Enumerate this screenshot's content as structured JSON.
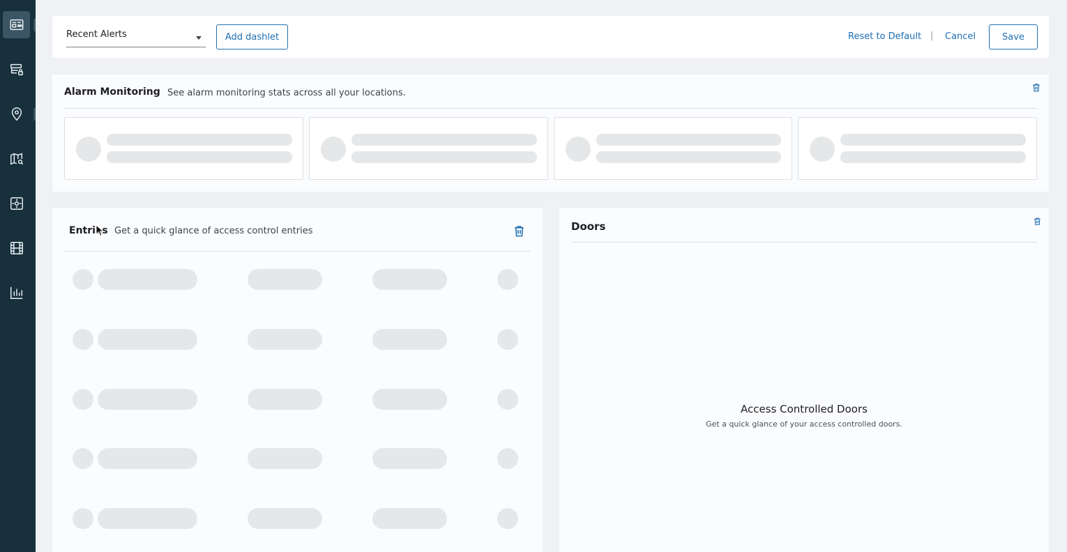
{
  "sidebar": {
    "items": [
      {
        "name": "dashboard",
        "icon": "dashboard-icon",
        "active": true
      },
      {
        "name": "devices",
        "icon": "server-lock-icon",
        "active": false
      },
      {
        "name": "locations",
        "icon": "location-pin-icon",
        "active": false
      },
      {
        "name": "maps",
        "icon": "map-search-icon",
        "active": false
      },
      {
        "name": "alarms",
        "icon": "sensor-icon",
        "active": false
      },
      {
        "name": "video",
        "icon": "film-icon",
        "active": false
      },
      {
        "name": "reports",
        "icon": "bar-chart-icon",
        "active": false
      }
    ]
  },
  "toolbar": {
    "dashlet_select_value": "Recent Alerts",
    "add_dashlet_label": "Add dashlet",
    "reset_label": "Reset to Default",
    "separator": "|",
    "cancel_label": "Cancel",
    "save_label": "Save"
  },
  "alarm_panel": {
    "title": "Alarm Monitoring",
    "subtitle": "See alarm monitoring stats across all your locations."
  },
  "entries_panel": {
    "title": "Entries",
    "subtitle": "Get a quick glance of access control entries"
  },
  "doors_panel": {
    "title": "Doors",
    "empty_title": "Access Controlled Doors",
    "empty_subtitle": "Get a quick glance of your access controlled doors."
  },
  "colors": {
    "sidebar_bg": "#17303c",
    "accent": "#1f6fb2",
    "skeleton": "#e6e7e9"
  }
}
